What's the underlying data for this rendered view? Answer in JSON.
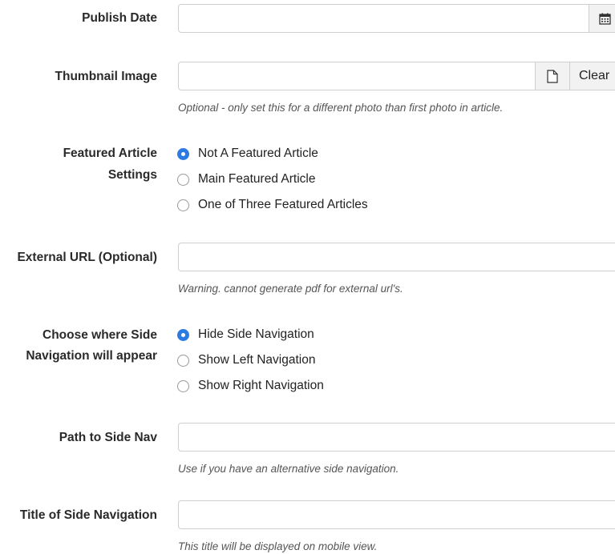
{
  "publish_date": {
    "label": "Publish Date",
    "value": "",
    "calendar_icon": "calendar-icon"
  },
  "thumbnail_image": {
    "label": "Thumbnail Image",
    "value": "",
    "file_icon": "file-icon",
    "clear_label": "Clear",
    "help": "Optional - only set this for a different photo than first photo in article."
  },
  "featured_article": {
    "label_line1": "Featured Article",
    "label_line2": "Settings",
    "options": [
      {
        "label": "Not A Featured Article",
        "checked": true
      },
      {
        "label": "Main Featured Article",
        "checked": false
      },
      {
        "label": "One of Three Featured Articles",
        "checked": false
      }
    ]
  },
  "external_url": {
    "label": "External URL (Optional)",
    "value": "",
    "help": "Warning. cannot generate pdf for external url's."
  },
  "side_nav_position": {
    "label_line1": "Choose where Side",
    "label_line2": "Navigation will appear",
    "options": [
      {
        "label": "Hide Side Navigation",
        "checked": true
      },
      {
        "label": "Show Left Navigation",
        "checked": false
      },
      {
        "label": "Show Right Navigation",
        "checked": false
      }
    ]
  },
  "side_nav_path": {
    "label": "Path to Side Nav",
    "value": "",
    "help": "Use if you have an alternative side navigation."
  },
  "side_nav_title": {
    "label": "Title of Side Navigation",
    "value": "",
    "help": "This title will be displayed on mobile view."
  },
  "colors": {
    "radio_checked": "#2d7be0",
    "border": "#cfcfcf",
    "addon_bg": "#f2f2f2"
  }
}
